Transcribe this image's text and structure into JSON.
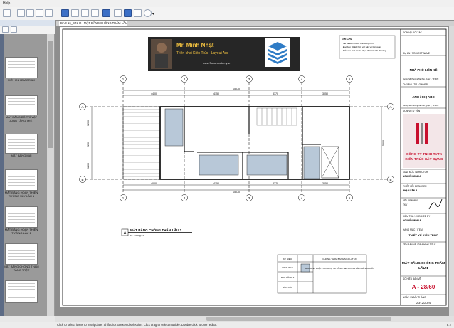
{
  "menu": {
    "label": "Help"
  },
  "tab": {
    "label": "BAO 16_BINH2 - MẶT BẰNG CHỐNG THẤM LẦU 1"
  },
  "left_panel": {
    "pages": [
      {
        "label": "MỞ HÌNH DIAGRAM"
      },
      {
        "label": "MẶT BẰNG BỐ TRÍ VẬT DỤNG TẦNG TRỆT"
      },
      {
        "label": "MẶT BẰNG MÁI"
      },
      {
        "label": "MẶT BẰNG HOÀN THIỆN TƯỜNG XÂY LẦU 1"
      },
      {
        "label": "MẶT BẰNG HOÀN THIỆN TƯỜNG LẦU 1"
      },
      {
        "label": "MẶT BẰNG CHỐNG THẤM TẦNG TRỆT"
      },
      {
        "label": ""
      }
    ]
  },
  "banner": {
    "name": "Mr. Minh Nhật",
    "subtitle": "Triển khai Kiến Trúc - Layout Arc",
    "url": "www.Tuvancademy.vn"
  },
  "drawing": {
    "total_dim": "15070",
    "top_dims": [
      "4400",
      "4150",
      "3370",
      "3050"
    ],
    "bottom_dims": [
      "4000",
      "4150",
      "3370",
      "3050"
    ],
    "overall_bottom": "15070",
    "grid_top": [
      "1",
      "2",
      "3",
      "4",
      "5"
    ],
    "grid_side": [
      "A",
      "B"
    ],
    "side_dims": [
      "1200",
      "2200",
      "1200"
    ],
    "side_total": "5000"
  },
  "caption": {
    "letter": "A",
    "title": "MẶT BẰNG CHỐNG THẤM LẦU 1",
    "scale": "TL: 1/100@A3"
  },
  "legend": {
    "header_left": "KÝ HIỆU",
    "header_right": "CHỐNG THẤM BẰNG SIKA LATEX",
    "rows": [
      "WC2, WC3",
      "BAN CÔNG 1",
      "BỒN CÂY"
    ],
    "note": "SIKA LATEX HOẶC TƯƠNG TỰ, THI CÔNG THEO HƯỚNG DẪN NHÀ SẢN XUẤT"
  },
  "notes": {
    "title": "GHI CHÚ",
    "lines": [
      "- Tất cả kích thước tính bằng mm",
      "- Đọc bản vẽ kết hợp với bản vẽ liên quan",
      "- Kiểm tra kích thước thực tế trước khi thi công"
    ]
  },
  "title_block": {
    "company_label": "ĐƠN VỊ / ĐỐI TÁC",
    "project_label": "DỰ ÁN / PROJECT NAME",
    "project_name": "NHÀ PHỐ LIÊN KẾ",
    "address_label": "Đường Số, Phường Tân Phú, Quận 9, TP.HCM",
    "owner_label": "CHỦ ĐẦU TƯ / OWNER",
    "owner_name": "ANH / CHỊ ABC",
    "owner_addr": "Đường Số, Phường Tân Phú, Quận 9, TP.HCM",
    "consultant_label": "ĐƠN VỊ TƯ VẤN",
    "company_name_1": "CÔNG TY TNHH TVTK",
    "company_name_2": "KIẾN TRÚC XÂY DỰNG",
    "director_label": "GIÁM ĐỐC / DIRECTOR",
    "director_name": "NGUYỄN MINH A",
    "designer_label": "THIẾT KẾ / DESIGNER",
    "designer_name": "PHẠM VĂN B",
    "drawn_label": "VẼ / DRAWING",
    "drawn_name": "TKV",
    "checked_label": "KIỂM TRA / CHECKED BY",
    "checked_name": "NGUYỄN MINH A",
    "phase_label": "HẠNG MỤC / ITEM",
    "phase_name": "THIẾT KẾ KIẾN TRÚC",
    "title_label": "TÊN BẢN VẼ / DRAWING TITLE",
    "sheet_title_1": "MẶT BẰNG CHỐNG THẤM",
    "sheet_title_2": "LẦU 1",
    "sheet_no_label": "SỐ HIỆU BẢN VẼ",
    "sheet_no": "A - 28/60",
    "date_label": "NGÀY / NGÀY THÁNG",
    "date": "20/12/2024"
  },
  "status": {
    "text": "Click to select items to manipulate. Shift click to extend selection. Click drag to select multiple. Double click to open editor.",
    "zoom": "4 ×"
  },
  "colors": {
    "wet_area": "#b8c8d8",
    "accent_red": "#c8102e",
    "banner_bg": "#2a2a2a"
  }
}
